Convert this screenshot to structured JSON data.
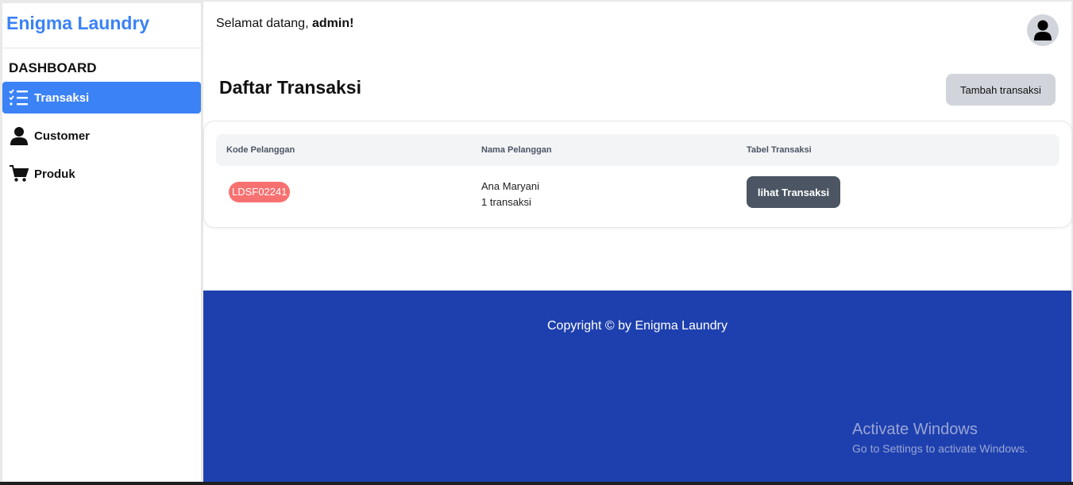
{
  "sidebar": {
    "brand": "Enigma Laundry",
    "section_label": "DASHBOARD",
    "items": [
      {
        "label": "Transaksi",
        "icon": "list-check-icon",
        "active": true
      },
      {
        "label": "Customer",
        "icon": "user-icon",
        "active": false
      },
      {
        "label": "Produk",
        "icon": "cart-icon",
        "active": false
      }
    ]
  },
  "header": {
    "welcome_prefix": "Selamat datang, ",
    "username": "admin!",
    "avatar_icon": "user-avatar-icon"
  },
  "main": {
    "title": "Daftar Transaksi",
    "add_button": "Tambah transaksi",
    "table": {
      "columns": [
        "Kode Pelanggan",
        "Nama Pelanggan",
        "Tabel Transaksi"
      ],
      "rows": [
        {
          "kode": "LDSF02241",
          "nama": "Ana Maryani",
          "jumlah": "1 transaksi",
          "action": "lihat Transaksi"
        }
      ]
    }
  },
  "footer": {
    "copyright": "Copyright © by Enigma Laundry"
  },
  "watermark": {
    "title": "Activate Windows",
    "subtitle": "Go to Settings to activate Windows."
  },
  "colors": {
    "accent": "#3b82f6",
    "footer": "#1e40af",
    "badge": "#f87171",
    "action_button": "#4b5563"
  }
}
